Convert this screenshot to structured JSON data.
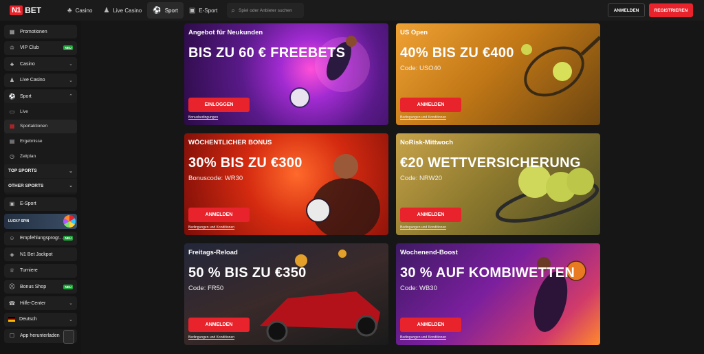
{
  "header": {
    "logo_mark": "N1",
    "logo_text": "BET",
    "nav": [
      {
        "label": "Casino",
        "icon": "clubs-icon"
      },
      {
        "label": "Live Casino",
        "icon": "dealer-icon"
      },
      {
        "label": "Sport",
        "icon": "football-icon",
        "active": true
      },
      {
        "label": "E-Sport",
        "icon": "gamepad-icon"
      }
    ],
    "search_placeholder": "Spiel oder Anbieter suchen",
    "login_label": "ANMELDEN",
    "register_label": "REGISTRIEREN"
  },
  "sidebar": {
    "promotionen": "Promotionen",
    "vip_club": "VIP Club",
    "new_badge": "NEU",
    "casino": "Casino",
    "live_casino": "Live Casino",
    "sport": "Sport",
    "live": "Live",
    "sportaktionen": "Sportaktionen",
    "ergebnisse": "Ergebnisse",
    "zeitplan": "Zeitplan",
    "top_sports": "TOP SPORTS",
    "other_sports": "OTHER SPORTS",
    "esport": "E-Sport",
    "lucky_spin": "LUCKY SPIN",
    "empfehlung": "Empfehlungsprogr...",
    "jackpot": "N1 Bet Jackpot",
    "turniere": "Turniere",
    "bonus_shop": "Bonus Shop",
    "hilfe": "Hilfe-Center",
    "deutsch": "Deutsch",
    "app": "App herunterladen"
  },
  "promos": [
    {
      "title": "Angebot für Neukunden",
      "headline": "BIS ZU 60 € FREEBETS",
      "code": "",
      "button": "EINLOGGEN",
      "terms": "Bonusbedingungen"
    },
    {
      "title": "US Open",
      "headline": "40% BIS ZU €400",
      "code": "Code: USO40",
      "button": "ANMELDEN",
      "terms": "Bedingungen und Konditionen"
    },
    {
      "title": "WÖCHENTLICHER BONUS",
      "headline": "30% BIS ZU €300",
      "code": "Bonuscode: WR30",
      "button": "ANMELDEN",
      "terms": "Bedingungen und Konditionen"
    },
    {
      "title": "NoRisk-Mittwoch",
      "headline": "€20 WETTVERSICHERUNG",
      "code": "Code: NRW20",
      "button": "ANMELDEN",
      "terms": "Bedingungen und Konditionen"
    },
    {
      "title": "Freitags-Reload",
      "headline": "50 % BIS ZU €350",
      "code": "Code: FR50",
      "button": "ANMELDEN",
      "terms": "Bedingungen und Konditionen"
    },
    {
      "title": "Wochenend-Boost",
      "headline": "30 % AUF KOMBIWETTEN",
      "code": "Code: WB30",
      "button": "ANMELDEN",
      "terms": "Bedingungen und Konditionen"
    }
  ],
  "colors": {
    "accent": "#e8232b",
    "new_badge": "#1fa33a"
  }
}
